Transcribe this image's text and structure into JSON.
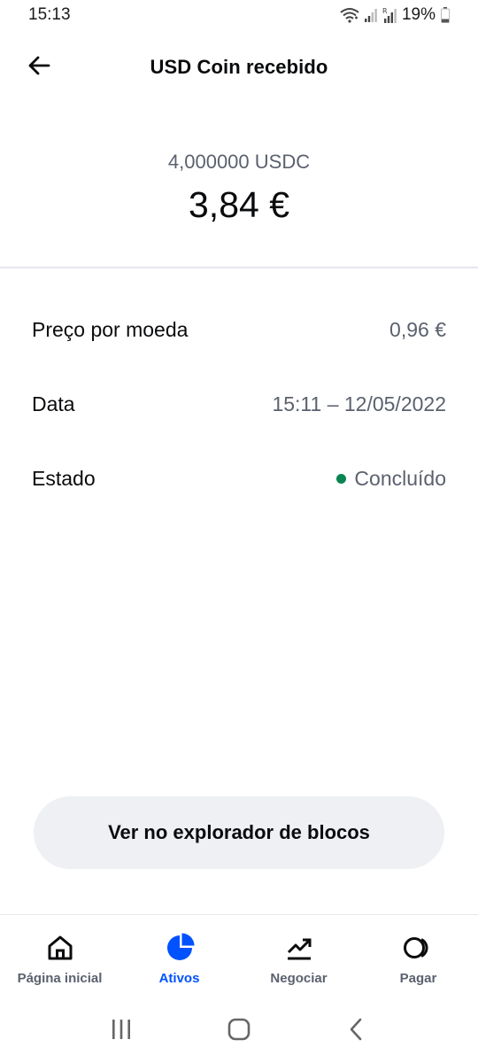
{
  "status_bar": {
    "time": "15:13",
    "battery": "19%",
    "icons": [
      "wifi-icon",
      "signal-icon",
      "signal-roaming-icon",
      "battery-icon"
    ]
  },
  "header": {
    "title": "USD Coin recebido",
    "back_icon": "arrow-left-icon"
  },
  "amount": {
    "crypto": "4,000000 USDC",
    "fiat": "3,84 €"
  },
  "details": [
    {
      "label": "Preço por moeda",
      "value": "0,96 €"
    },
    {
      "label": "Data",
      "value": "15:11 – 12/05/2022"
    },
    {
      "label": "Estado",
      "value": "Concluído",
      "status_color": "#098551"
    }
  ],
  "explorer_button": {
    "label": "Ver no explorador de blocos"
  },
  "bottom_nav": {
    "items": [
      {
        "label": "Página inicial",
        "icon": "home-icon",
        "active": false
      },
      {
        "label": "Ativos",
        "icon": "pie-chart-icon",
        "active": true
      },
      {
        "label": "Negociar",
        "icon": "trend-chart-icon",
        "active": false
      },
      {
        "label": "Pagar",
        "icon": "pay-circles-icon",
        "active": false
      }
    ]
  },
  "system_nav": {
    "icons": [
      "recent-apps-icon",
      "home-circle-icon",
      "back-chevron-icon"
    ]
  },
  "colors": {
    "accent": "#0052ff",
    "text_primary": "#0a0b0d",
    "text_secondary": "#5b616e",
    "success": "#098551",
    "button_bg": "#eef0f3"
  }
}
